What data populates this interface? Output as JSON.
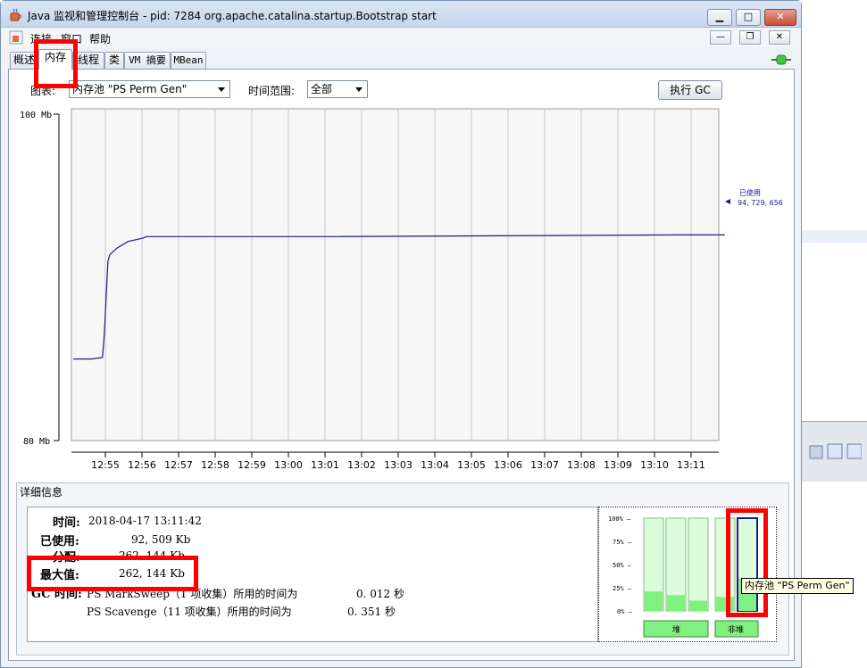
{
  "window": {
    "title": "Java 监视和管理控制台 - pid: 7284 org.apache.catalina.startup.Bootstrap start"
  },
  "menu": [
    "连接",
    "窗口",
    "帮助"
  ],
  "tabs": [
    "概述",
    "内存",
    "线程",
    "类",
    "VM 摘要",
    "MBean"
  ],
  "toolbar": {
    "chart_label": "图表:",
    "chart_selected": "内存池 \"PS Perm Gen\"",
    "time_range_label": "时间范围:",
    "time_range_selected": "全部",
    "gc_button": "执行 GC"
  },
  "chart_data": {
    "type": "line",
    "ymax_label": "100 Mb",
    "ymin_label": "80 Mb",
    "ylim": [
      80,
      100
    ],
    "x_ticks": [
      "12:55",
      "12:56",
      "12:57",
      "12:58",
      "12:59",
      "13:00",
      "13:01",
      "13:02",
      "13:03",
      "13:04",
      "13:05",
      "13:06",
      "13:07",
      "13:08",
      "13:09",
      "13:10",
      "13:11"
    ],
    "series": [
      {
        "name": "已使用",
        "x_minutes_since_1254": [
          0,
          0.5,
          0.8,
          0.85,
          0.95,
          1.0,
          1.2,
          1.5,
          1.9,
          2.0,
          2.2,
          2.4,
          3.2,
          7.2,
          16.5,
          17.8
        ],
        "values": [
          85.0,
          85.0,
          85.1,
          86.5,
          91.0,
          91.4,
          91.8,
          92.2,
          92.4,
          92.5,
          92.5,
          92.5,
          92.5,
          92.5,
          92.6,
          92.6
        ]
      }
    ],
    "legend_name": "已使用",
    "legend_value": "94, 729, 656"
  },
  "details": {
    "title": "详细信息",
    "time_label": "时间:",
    "time_value": "2018-04-17 13:11:42",
    "used_label": "已使用:",
    "used_value": "92, 509 Kb",
    "committed_label": "分配:",
    "committed_value": "262, 144 Kb",
    "max_label": "最大值:",
    "max_value": "262, 144 Kb",
    "gc_label": "GC 时间:",
    "gc1_text": "PS MarkSweep（1 项收集）所用的时间为",
    "gc1_value": "0. 012 秒",
    "gc2_text": "PS Scavenge（11 项收集）所用的时间为",
    "gc2_value": "0. 351 秒"
  },
  "pool_bars": {
    "ticks": [
      "100% —",
      "75% —",
      "50% —",
      "25% —",
      "0% —"
    ],
    "levels": [
      0.21,
      0.17,
      0.11,
      0.15,
      0.35
    ],
    "heap_label": "堆",
    "nonheap_label": "非堆"
  },
  "tooltip": "内存池 \"PS Perm Gen\"",
  "colors": {
    "series_line": "#1a1a8c",
    "bar_fill": "#dcfcdc",
    "bar_level": "#80f080",
    "highlight_red": "#ff0000"
  }
}
